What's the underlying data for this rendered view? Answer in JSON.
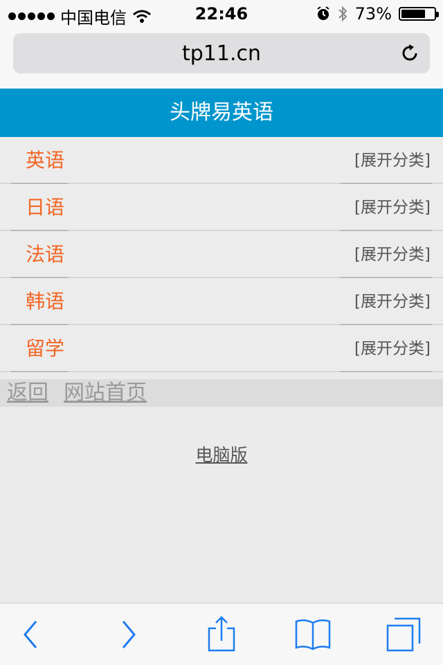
{
  "status_bar": {
    "carrier": "中国电信",
    "time": "22:46",
    "battery_percent": "73%",
    "battery_level": 0.73
  },
  "url_bar": {
    "url": "tp11.cn"
  },
  "header": {
    "title": "头牌易英语"
  },
  "menu": {
    "expand_label": "[展开分类]",
    "items": [
      {
        "label": "英语"
      },
      {
        "label": "日语"
      },
      {
        "label": "法语"
      },
      {
        "label": "韩语"
      },
      {
        "label": "留学"
      }
    ]
  },
  "footer_links": {
    "back": "返回",
    "home": "网站首页",
    "desktop": "电脑版"
  },
  "colors": {
    "header_bg": "#0096cd",
    "accent_orange": "#f26522",
    "toolbar_icon": "#1e7cf0"
  }
}
